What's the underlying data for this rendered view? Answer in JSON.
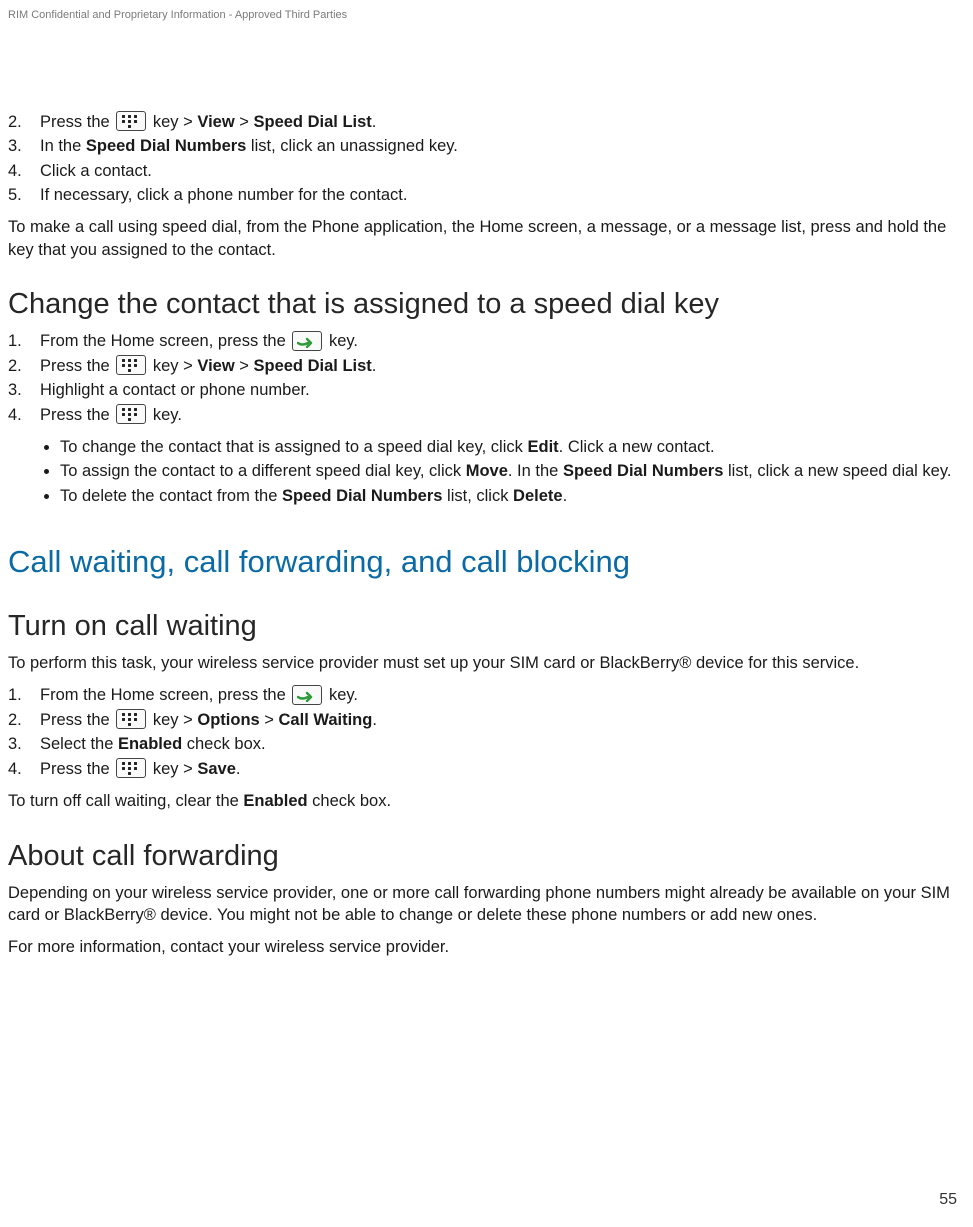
{
  "header": {
    "confidential": "RIM Confidential and Proprietary Information - Approved Third Parties"
  },
  "page_number": "55",
  "top_list": {
    "items": [
      {
        "num": "2.",
        "t1": "Press the ",
        "t2": " key > ",
        "b1": "View",
        "t3": " > ",
        "b2": "Speed Dial List",
        "t4": "."
      },
      {
        "num": "3.",
        "t1": "In the ",
        "b1": "Speed Dial Numbers",
        "t2": " list, click an unassigned key."
      },
      {
        "num": "4.",
        "t1": "Click a contact."
      },
      {
        "num": "5.",
        "t1": "If necessary, click a phone number for the contact."
      }
    ],
    "after": "To make a call using speed dial, from the Phone application, the Home screen, a message, or a message list, press and hold the key that you assigned to the contact."
  },
  "sec1": {
    "title": "Change the contact that is assigned to a speed dial key",
    "items": [
      {
        "num": "1.",
        "t1": "From the Home screen, press the ",
        "t2": " key."
      },
      {
        "num": "2.",
        "t1": "Press the ",
        "t2": " key > ",
        "b1": "View",
        "t3": " > ",
        "b2": "Speed Dial List",
        "t4": "."
      },
      {
        "num": "3.",
        "t1": "Highlight a contact or phone number."
      },
      {
        "num": "4.",
        "t1": "Press the ",
        "t2": " key."
      }
    ],
    "bullets": [
      {
        "t1": "To change the contact that is assigned to a speed dial key, click ",
        "b1": "Edit",
        "t2": ". Click a new contact."
      },
      {
        "t1": "To assign the contact to a different speed dial key, click ",
        "b1": "Move",
        "t2": ". In the ",
        "b2": "Speed Dial Numbers",
        "t3": " list, click a new speed dial key."
      },
      {
        "t1": "To delete the contact from the ",
        "b1": "Speed Dial Numbers",
        "t2": " list, click ",
        "b2": "Delete",
        "t3": "."
      }
    ]
  },
  "chapter": {
    "title": "Call waiting, call forwarding, and call blocking"
  },
  "sec2": {
    "title": "Turn on call waiting",
    "intro": "To perform this task, your wireless service provider must set up your SIM card or BlackBerry® device for this service.",
    "items": [
      {
        "num": "1.",
        "t1": "From the Home screen, press the ",
        "t2": " key."
      },
      {
        "num": "2.",
        "t1": "Press the ",
        "t2": " key > ",
        "b1": "Options",
        "t3": " > ",
        "b2": "Call Waiting",
        "t4": "."
      },
      {
        "num": "3.",
        "t1": "Select the ",
        "b1": "Enabled",
        "t2": " check box."
      },
      {
        "num": "4.",
        "t1": "Press the ",
        "t2": " key > ",
        "b1": "Save",
        "t3": "."
      }
    ],
    "after_t1": "To turn off call waiting, clear the ",
    "after_b1": "Enabled",
    "after_t2": " check box."
  },
  "sec3": {
    "title": "About call forwarding",
    "p1": "Depending on your wireless service provider, one or more call forwarding phone numbers might already be available on your SIM card or BlackBerry® device. You might not be able to change or delete these phone numbers or add new ones.",
    "p2": "For more information, contact your wireless service provider."
  }
}
